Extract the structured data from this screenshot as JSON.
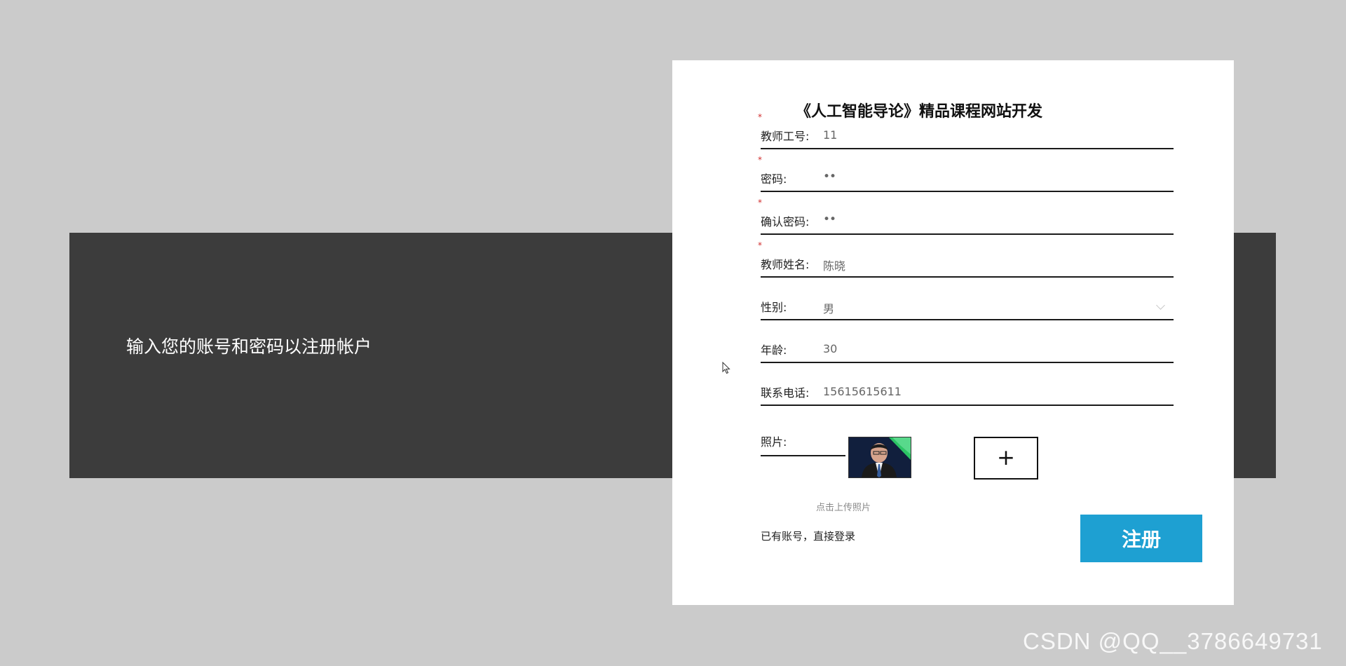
{
  "page": {
    "background": "#cbcbcb"
  },
  "band": {
    "text": "输入您的账号和密码以注册帐户",
    "background": "#3c3c3c"
  },
  "form": {
    "title": "《人工智能导论》精品课程网站开发",
    "rows": [
      {
        "label": "教师工号:",
        "value": "11",
        "required": true
      },
      {
        "label": "密码:",
        "value": "••",
        "required": true
      },
      {
        "label": "确认密码:",
        "value": "••",
        "required": true
      },
      {
        "label": "教师姓名:",
        "value": "陈晓",
        "required": true
      },
      {
        "label": "性别:",
        "value": "男",
        "required": false,
        "select": true
      },
      {
        "label": "年龄:",
        "value": "30",
        "required": false
      },
      {
        "label": "联系电话:",
        "value": "15615615611",
        "required": false
      }
    ],
    "required_mark": "*",
    "photo": {
      "label": "照片:",
      "upload_button": "+",
      "hint": "点击上传照片"
    },
    "login_link": "已有账号，直接登录",
    "register_button": "注册",
    "accent_color": "#1ea0d2"
  },
  "watermark": "CSDN @QQ__3786649731"
}
